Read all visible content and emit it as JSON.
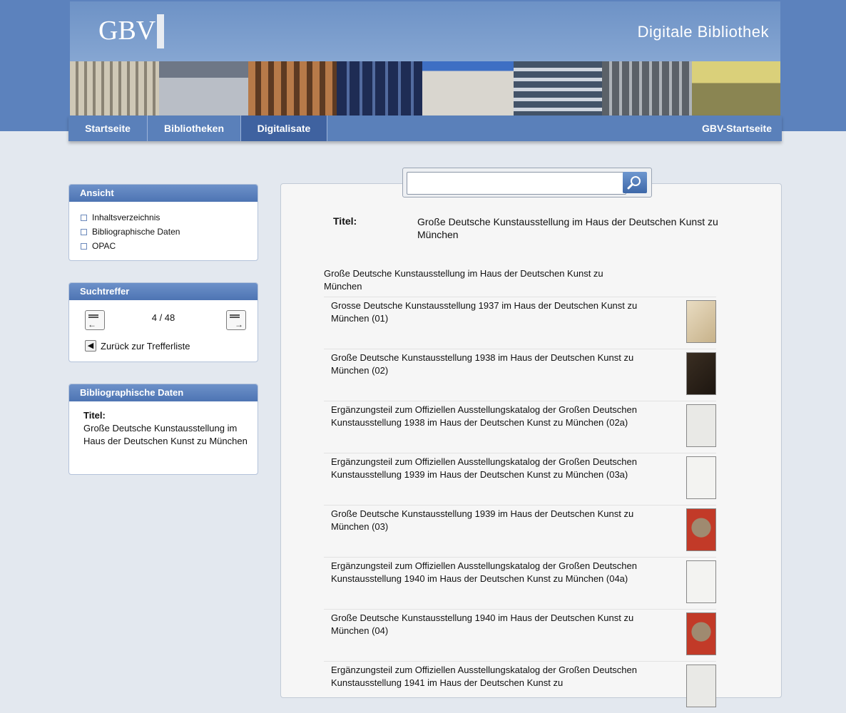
{
  "header": {
    "logo_text": "GBV",
    "site_title": "Digitale Bibliothek"
  },
  "nav": {
    "items": [
      "Startseite",
      "Bibliotheken",
      "Digitalisate"
    ],
    "active": "Digitalisate",
    "right": "GBV-Startseite"
  },
  "sidebar": {
    "ansicht": {
      "title": "Ansicht",
      "items": [
        "Inhaltsverzeichnis",
        "Bibliographische Daten",
        "OPAC"
      ]
    },
    "suchtreffer": {
      "title": "Suchtreffer",
      "count": "4 / 48",
      "back": "Zurück zur Trefferliste"
    },
    "bib": {
      "title": "Bibliographische Daten",
      "label": "Titel:",
      "value": "Große Deutsche Kunstausstellung im Haus der Deutschen Kunst zu München"
    }
  },
  "search": {
    "placeholder": ""
  },
  "main": {
    "title_label": "Titel:",
    "title_value": "Große Deutsche Kunstausstellung im Haus der Deutschen Kunst zu München",
    "parent_title": "Große Deutsche Kunstausstellung im Haus der Deutschen Kunst zu München",
    "volumes": [
      "Grosse Deutsche Kunstausstellung 1937 im Haus der Deutschen Kunst zu München (01)",
      "Große Deutsche Kunstausstellung 1938 im Haus der Deutschen Kunst zu München (02)",
      "Ergänzungsteil zum Offiziellen Ausstellungskatalog der Großen Deutschen Kunstausstellung 1938 im Haus der Deutschen Kunst zu München (02a)",
      "Ergänzungsteil zum Offiziellen Ausstellungskatalog der Großen Deutschen Kunstausstellung 1939 im Haus der Deutschen Kunst zu München (03a)",
      "Große Deutsche Kunstausstellung 1939 im Haus der Deutschen Kunst zu München (03)",
      "Ergänzungsteil zum Offiziellen Ausstellungskatalog der Großen Deutschen Kunstausstellung 1940 im Haus der Deutschen Kunst zu München (04a)",
      "Große Deutsche Kunstausstellung 1940 im Haus der Deutschen Kunst zu München (04)",
      "Ergänzungsteil zum Offiziellen Ausstellungskatalog der Großen Deutschen Kunstausstellung 1941 im Haus der Deutschen Kunst zu"
    ]
  }
}
